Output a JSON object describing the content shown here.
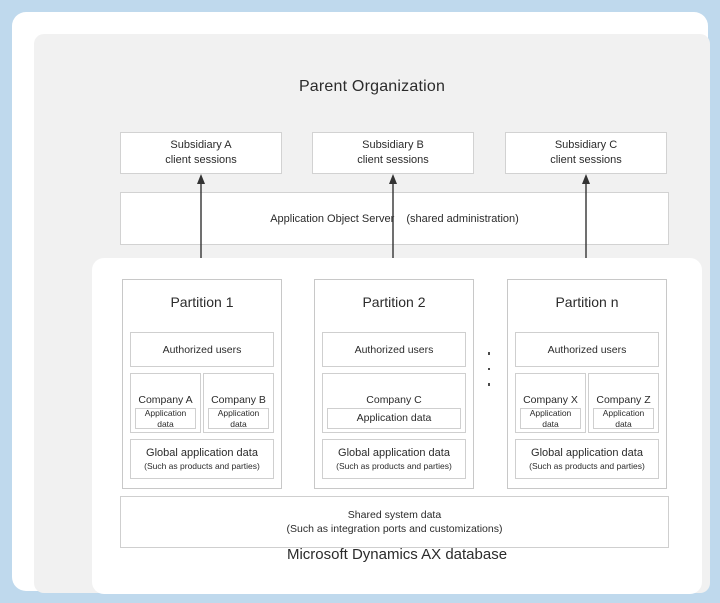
{
  "diagram": {
    "title": "Parent Organization",
    "database_label": "Microsoft Dynamics AX database"
  },
  "subsidiaries": [
    {
      "name": "Subsidiary A",
      "sub": "client sessions"
    },
    {
      "name": "Subsidiary B",
      "sub": "client sessions"
    },
    {
      "name": "Subsidiary C",
      "sub": "client sessions"
    }
  ],
  "aos": {
    "label": "Application Object Server",
    "note": "(shared administration)"
  },
  "arrows": {
    "count": 3,
    "style": "double-headed-vertical",
    "color": "#333333"
  },
  "ellipsis": {
    "dots": 3,
    "meaning": "additional partitions"
  },
  "partitions": [
    {
      "title": "Partition 1",
      "authorized_users": "Authorized users",
      "companies": [
        {
          "name": "Company A",
          "app_data_line1": "Application",
          "app_data_line2": "data"
        },
        {
          "name": "Company B",
          "app_data_line1": "Application",
          "app_data_line2": "data"
        }
      ],
      "global_data": "Global application data",
      "global_data_sub": "(Such as products and parties)"
    },
    {
      "title": "Partition 2",
      "authorized_users": "Authorized users",
      "companies": [
        {
          "name": "Company C",
          "app_data_line1": "Application data",
          "app_data_line2": ""
        }
      ],
      "global_data": "Global application data",
      "global_data_sub": "(Such as products and parties)"
    },
    {
      "title": "Partition n",
      "authorized_users": "Authorized users",
      "companies": [
        {
          "name": "Company X",
          "app_data_line1": "Application",
          "app_data_line2": "data"
        },
        {
          "name": "Company Z",
          "app_data_line1": "Application",
          "app_data_line2": "data"
        }
      ],
      "global_data": "Global application data",
      "global_data_sub": "(Such as products and parties)"
    }
  ],
  "shared_system": {
    "label": "Shared system data",
    "note": "(Such as integration ports and customizations)"
  },
  "colors": {
    "page_background": "#bfd9ed",
    "frame": "#ffffff",
    "parent_panel": "#f1f1f1",
    "box_border": "#cfcfcf",
    "text": "#2b2b2b"
  }
}
